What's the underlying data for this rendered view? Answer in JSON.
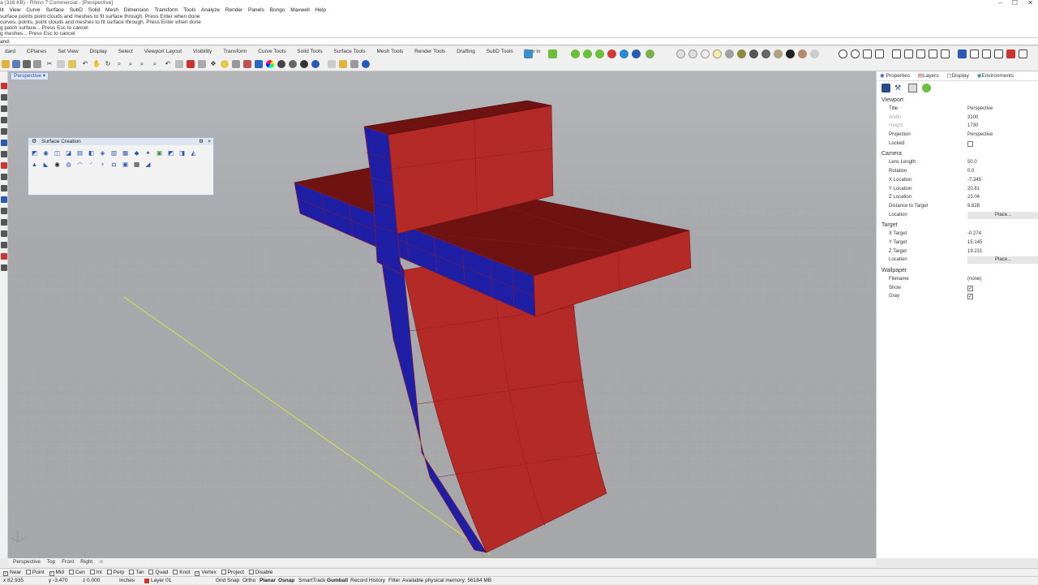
{
  "window": {
    "title": "a (316 KB) - Rhino 7 Commercial - [Perspective]",
    "controls": [
      "–",
      "☐",
      "✕"
    ]
  },
  "menu": [
    "lit",
    "View",
    "Curve",
    "Surface",
    "SubD",
    "Solid",
    "Mesh",
    "Dimension",
    "Transform",
    "Tools",
    "Analyze",
    "Render",
    "Panels",
    "Bongo",
    "Maxwell",
    "Help"
  ],
  "command_history": [
    "surface points point clouds and meshes to fit surface through. Press Enter when done",
    "curves, points, point clouds and meshes to fit surface through. Press Enter when done",
    "g patch surface... Press Esc to cancel",
    "g meshes... Press Esc to cancel"
  ],
  "command_prompt": "and:",
  "toolbar_tabs": [
    "dard",
    "CPlanes",
    "Set View",
    "Display",
    "Select",
    "Viewport Layout",
    "Visibility",
    "Transform",
    "Curve Tools",
    "Solid Tools",
    "Surface Tools",
    "Mesh Tools",
    "Render Tools",
    "Drafting",
    "SubD Tools",
    "New in"
  ],
  "viewport": {
    "active_label": "Perspective",
    "tabs": [
      "Perspective",
      "Top",
      "Front",
      "Right"
    ],
    "colors": {
      "red": "#b42a27",
      "red_dark": "#6e1212",
      "blue": "#1f1fa6",
      "grid": "#9c9ea1",
      "axis_y": "#d8e04a"
    }
  },
  "surface_creation_panel": {
    "title": "Surface Creation",
    "icons": [
      "corner-points-icon",
      "sphere-icon",
      "edge-curves-icon",
      "planar-curves-icon",
      "rectangle-surface-icon",
      "extrude-icon",
      "loft-icon",
      "sweep-icon",
      "rail-revolve-icon",
      "blend-icon",
      "network-icon",
      "patch-icon",
      "drape-icon",
      "heightfield-icon",
      "cone-icon",
      "pipe-icon",
      "torus-icon",
      "revolve-icon",
      "fillet-icon",
      "cap-icon",
      "unroll-icon",
      "heightmap-icon",
      "grid-icon",
      "wire-icon"
    ]
  },
  "properties_panel": {
    "tabs": [
      "Properties",
      "Layers",
      "Display",
      "Environments"
    ],
    "sections": [
      {
        "title": "Viewport",
        "rows": [
          {
            "label": "Title",
            "value": "Perspective"
          },
          {
            "label": "Width",
            "value": "3100",
            "dim": true
          },
          {
            "label": "Height",
            "value": "1730",
            "dim": true
          },
          {
            "label": "Projection",
            "value": "Perspective"
          },
          {
            "label": "Locked",
            "checkbox": false
          }
        ]
      },
      {
        "title": "Camera",
        "rows": [
          {
            "label": "Lens Length",
            "value": "50.0"
          },
          {
            "label": "Rotation",
            "value": "0.0"
          },
          {
            "label": "X Location",
            "value": "-7.345"
          },
          {
            "label": "Y Location",
            "value": "20.81"
          },
          {
            "label": "Z Location",
            "value": "23.04"
          },
          {
            "label": "Distance to Target",
            "value": "9.828"
          },
          {
            "label": "Location",
            "button": "Place..."
          }
        ]
      },
      {
        "title": "Target",
        "rows": [
          {
            "label": "X Target",
            "value": "-0.274"
          },
          {
            "label": "Y Target",
            "value": "15.145"
          },
          {
            "label": "Z Target",
            "value": "19.231"
          },
          {
            "label": "Location",
            "button": "Place..."
          }
        ]
      },
      {
        "title": "Wallpaper",
        "rows": [
          {
            "label": "Filename",
            "value": "(none)"
          },
          {
            "label": "Show",
            "checkbox": true
          },
          {
            "label": "Gray",
            "checkbox": true
          }
        ]
      }
    ]
  },
  "osnap": [
    {
      "label": "Near",
      "checked": true
    },
    {
      "label": "Point",
      "checked": false
    },
    {
      "label": "Mid",
      "checked": true
    },
    {
      "label": "Cen",
      "checked": false
    },
    {
      "label": "Int",
      "checked": false
    },
    {
      "label": "Perp",
      "checked": false
    },
    {
      "label": "Tan",
      "checked": false
    },
    {
      "label": "Quad",
      "checked": false
    },
    {
      "label": "Knot",
      "checked": false
    },
    {
      "label": "Vertex",
      "checked": true
    },
    {
      "label": "Project",
      "checked": false
    },
    {
      "label": "Disable",
      "checked": false
    }
  ],
  "status": {
    "x": "x 82.935",
    "y": "y -3.470",
    "z": "z 0.000",
    "units": "Inches",
    "layer": "Layer 01",
    "toggles": [
      "Grid Snap",
      "Ortho",
      "Planar",
      "Osnap",
      "SmartTrack",
      "Gumball",
      "Record History",
      "Filter"
    ],
    "memory": "Available physical memory: 56184 MB"
  }
}
